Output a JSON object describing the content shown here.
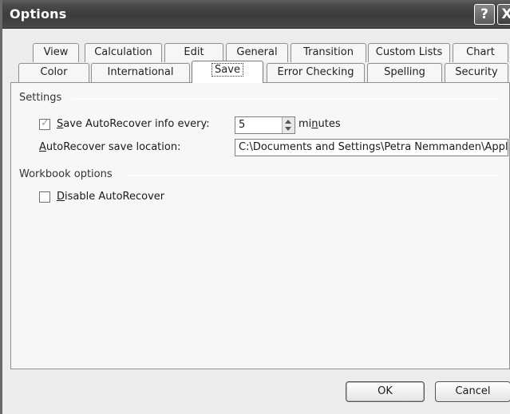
{
  "window": {
    "title": "Options",
    "help_icon": "?",
    "close_icon": "X"
  },
  "tabs": {
    "row1": [
      {
        "label": "View"
      },
      {
        "label": "Calculation"
      },
      {
        "label": "Edit"
      },
      {
        "label": "General"
      },
      {
        "label": "Transition"
      },
      {
        "label": "Custom Lists"
      },
      {
        "label": "Chart"
      }
    ],
    "row2": [
      {
        "label": "Color"
      },
      {
        "label": "International"
      },
      {
        "label": "Save",
        "selected": true
      },
      {
        "label": "Error Checking"
      },
      {
        "label": "Spelling"
      },
      {
        "label": "Security"
      }
    ]
  },
  "settings": {
    "group_label": "Settings",
    "autorecover_checkbox": {
      "prefix": "",
      "accel": "S",
      "rest": "ave AutoRecover info every:",
      "checked": true
    },
    "interval_value": "5",
    "minutes_label": {
      "pre": "mi",
      "accel": "n",
      "post": "utes"
    },
    "location_label": {
      "accel": "A",
      "rest": "utoRecover save location:"
    },
    "location_value": "C:\\Documents and Settings\\Petra Nemmanden\\Applic"
  },
  "workbook": {
    "group_label": "Workbook options",
    "disable_checkbox": {
      "accel": "D",
      "rest": "isable AutoRecover",
      "checked": false
    }
  },
  "buttons": {
    "ok": "OK",
    "cancel": "Cancel"
  }
}
